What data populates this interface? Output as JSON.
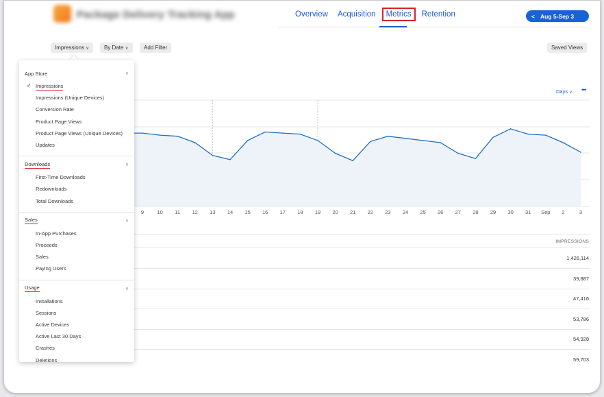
{
  "header": {
    "app_title": "Package Delivery Tracking App",
    "tabs": [
      {
        "label": "Overview",
        "active": false
      },
      {
        "label": "Acquisition",
        "active": false
      },
      {
        "label": "Metrics",
        "active": true
      },
      {
        "label": "Retention",
        "active": false
      }
    ],
    "date_range": "Aug 5-Sep 3",
    "back_glyph": "<"
  },
  "toolbar": {
    "metric_label": "Impressions",
    "group_label": "By Date",
    "filter_label": "Add Filter",
    "saved_views_label": "Saved Views",
    "caret": "∨"
  },
  "chart_controls": {
    "interval_label": "Days",
    "interval_caret": "∨",
    "more_glyph": "•••"
  },
  "chart_data": {
    "type": "area",
    "x_labels": [
      "9",
      "10",
      "11",
      "12",
      "13",
      "14",
      "15",
      "16",
      "17",
      "18",
      "19",
      "20",
      "21",
      "22",
      "23",
      "24",
      "25",
      "26",
      "27",
      "28",
      "29",
      "30",
      "31",
      "Sep",
      "2",
      "3"
    ],
    "values": [
      69,
      67,
      66,
      60,
      48,
      44,
      62,
      70,
      69,
      68,
      62,
      50,
      43,
      61,
      66,
      64,
      62,
      60,
      50,
      45,
      65,
      73,
      68,
      67,
      60,
      51
    ],
    "ylim": [
      0,
      100
    ],
    "grid": true,
    "line_color": "#1f70c1",
    "fill_color": "#eef3fa"
  },
  "table": {
    "column_header": "IMPRESSIONS",
    "rows": [
      "1,426,114",
      "39,887",
      "47,416",
      "53,786",
      "54,928",
      "59,703"
    ]
  },
  "menu": {
    "sections": [
      {
        "title": "App Store",
        "marked": false,
        "chevron": "∨",
        "items": [
          {
            "label": "Impressions",
            "checked": true
          },
          {
            "label": "Impressions (Unique Devices)",
            "checked": false
          },
          {
            "label": "Conversion Rate",
            "checked": false
          },
          {
            "label": "Product Page Views",
            "checked": false
          },
          {
            "label": "Product Page Views (Unique Devices)",
            "checked": false
          },
          {
            "label": "Updates",
            "checked": false
          }
        ]
      },
      {
        "title": "Downloads",
        "marked": true,
        "chevron": "∨",
        "items": [
          {
            "label": "First-Time Downloads",
            "checked": false
          },
          {
            "label": "Redownloads",
            "checked": false
          },
          {
            "label": "Total Downloads",
            "checked": false
          }
        ]
      },
      {
        "title": "Sales",
        "marked": true,
        "chevron": "∨",
        "items": [
          {
            "label": "In-App Purchases",
            "checked": false
          },
          {
            "label": "Proceeds",
            "checked": false
          },
          {
            "label": "Sales",
            "checked": false
          },
          {
            "label": "Paying Users",
            "checked": false
          }
        ]
      },
      {
        "title": "Usage",
        "marked": true,
        "chevron": "∨",
        "items": [
          {
            "label": "Installations",
            "checked": false
          },
          {
            "label": "Sessions",
            "checked": false
          },
          {
            "label": "Active Devices",
            "checked": false
          },
          {
            "label": "Active Last 30 Days",
            "checked": false
          },
          {
            "label": "Crashes",
            "checked": false
          },
          {
            "label": "Deletions",
            "checked": false
          }
        ]
      }
    ],
    "check_glyph": "✓"
  }
}
